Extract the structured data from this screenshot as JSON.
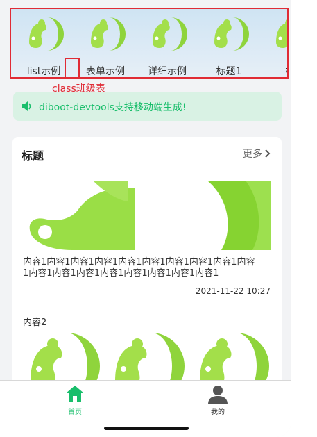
{
  "categories": [
    {
      "label": "list示例"
    },
    {
      "label": "表单示例"
    },
    {
      "label": "详细示例"
    },
    {
      "label": "标题1"
    },
    {
      "label": "标"
    }
  ],
  "annotation": {
    "label": "class班级表"
  },
  "notice": {
    "text": "diboot-devtools支持移动端生成!",
    "icon": "speaker-icon"
  },
  "card": {
    "title": "标题",
    "more_label": "更多",
    "item1": {
      "content": "内容1内容1内容1内容1内容1内容1内容1内容1内容1内容1内容1内容1内容1内容1内容1内容1内容1内容1",
      "time": "2021-11-22 10:27"
    },
    "item2": {
      "title": "内容2"
    }
  },
  "tabbar": {
    "home_label": "首页",
    "mine_label": "我的"
  },
  "colors": {
    "accent": "#19be6b",
    "annotation": "#e02b35",
    "logo": "#8fd43c"
  }
}
